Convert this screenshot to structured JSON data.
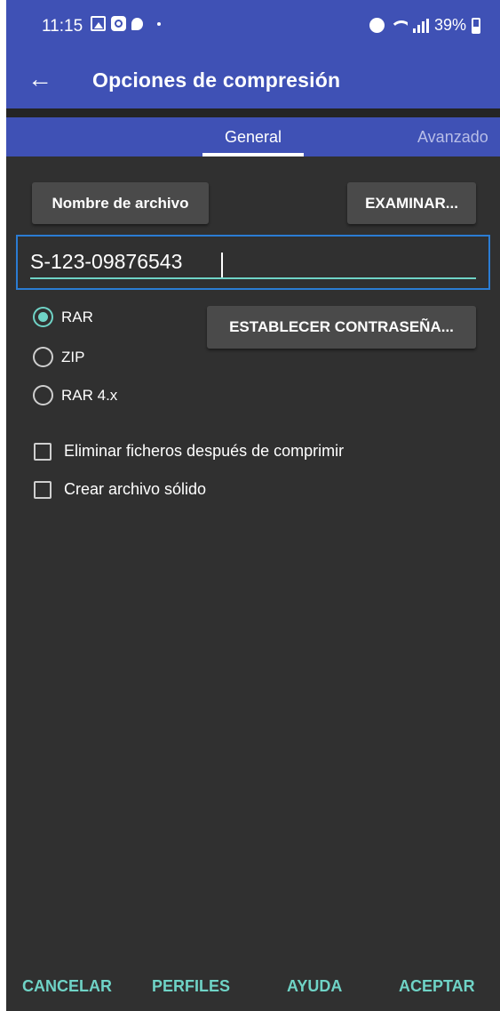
{
  "status_bar": {
    "time": "11:15",
    "battery": "39%",
    "icons": [
      "image-icon",
      "app-icon",
      "chat-icon",
      "dot-icon",
      "alarm-icon",
      "wifi-icon",
      "signal-icon",
      "battery-icon"
    ]
  },
  "app_bar": {
    "title": "Opciones de compresión",
    "back_icon": "←"
  },
  "tabs": [
    {
      "label": "General",
      "selected": true
    },
    {
      "label": "Avanzado",
      "selected": false
    }
  ],
  "filename_button": "Nombre de archivo",
  "browse_button": "EXAMINAR...",
  "filename_input": {
    "value": "S-123-09876543"
  },
  "password_button": "ESTABLECER CONTRASEÑA...",
  "formats": [
    {
      "label": "RAR",
      "checked": true
    },
    {
      "label": "ZIP",
      "checked": false
    },
    {
      "label": "RAR 4.x",
      "checked": false
    }
  ],
  "options": [
    {
      "label": "Eliminar ficheros después de comprimir",
      "checked": false
    },
    {
      "label": "Crear archivo sólido",
      "checked": false
    }
  ],
  "actions": {
    "cancel": "CANCELAR",
    "profiles": "PERFILES",
    "help": "AYUDA",
    "accept": "ACEPTAR"
  },
  "colors": {
    "primary": "#3f51b5",
    "background": "#303030",
    "accent": "#6fd3c6",
    "focus_border": "#2b7cd3"
  }
}
